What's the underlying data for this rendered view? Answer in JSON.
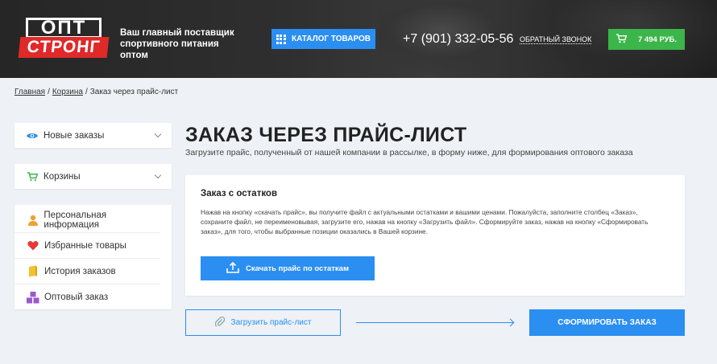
{
  "header": {
    "logo_line1": "ОПТ",
    "logo_line2": "СТРОНГ",
    "tagline": "Ваш главный поставщик спортивного питания оптом",
    "catalog_button": "КАТАЛОГ ТОВАРОВ",
    "phone": "+7 (901) 332-05-56",
    "callback": "ОБРАТНЫЙ ЗВОНОК",
    "cart_total": "7 494 РУБ."
  },
  "breadcrumb": {
    "home": "Главная",
    "cart": "Корзина",
    "current": "Заказ через прайс-лист"
  },
  "sidebar": {
    "dropdowns": [
      {
        "label": "Новые заказы",
        "icon": "eye-icon"
      },
      {
        "label": "Корзины",
        "icon": "cart-icon"
      }
    ],
    "menu": [
      {
        "label": "Персональная информация",
        "icon": "user-icon"
      },
      {
        "label": "Избранные товары",
        "icon": "heart-icon"
      },
      {
        "label": "История заказов",
        "icon": "history-icon"
      },
      {
        "label": "Оптовый заказ",
        "icon": "boxes-icon"
      }
    ]
  },
  "main": {
    "title": "ЗАКАЗ ЧЕРЕЗ ПРАЙС-ЛИСТ",
    "subtitle": "Загрузите прайс, полученный от нашей компании в рассылке, в форму ниже, для формирования оптового заказа",
    "card": {
      "title": "Заказ с остатков",
      "text": "Нажав на кнопку «скачать прайс», вы получите файл с актуальными остатками и вашими ценами. Пожалуйста, заполните столбец «Заказ», сохраните файл, не переименовывая, загрузите его, нажав на кнопку «Загрузить файл». Сформируйте заказ, нажав на кнопку «Сформировать заказ», для того, чтобы выбранные позиции оказались в Вашей корзине.",
      "download_button": "Скачать прайс по остаткам"
    },
    "upload_button": "Загрузить прайс-лист",
    "order_button": "СФОРМИРОВАТЬ ЗАКАЗ"
  },
  "colors": {
    "accent": "#2b8ef1",
    "cart": "#3cb54a",
    "logo_red": "#e02929",
    "header_bg": "#2a2a2a"
  }
}
